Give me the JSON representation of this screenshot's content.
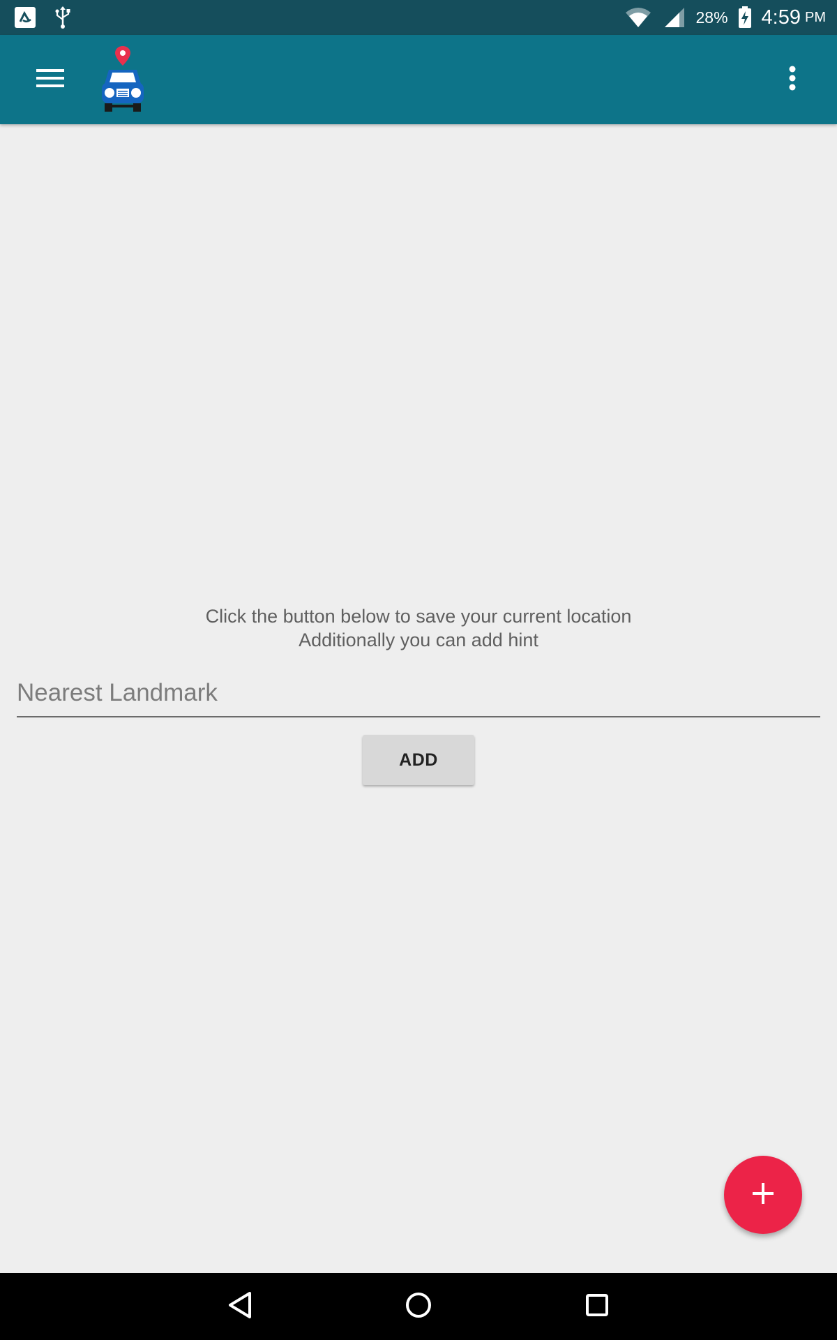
{
  "status_bar": {
    "battery_percent": "28%",
    "time": "4:59",
    "time_suffix": "PM",
    "icons": [
      "app-notification-icon",
      "usb-icon",
      "wifi-icon",
      "cell-signal-icon",
      "battery-charging-icon"
    ]
  },
  "app_bar": {
    "menu_icon": "hamburger-menu-icon",
    "logo_icon": "car-location-logo",
    "overflow_icon": "more-vertical-icon",
    "color": "#0d7489"
  },
  "main": {
    "instruction_line1": "Click the button below to save your current location",
    "instruction_line2": "Additionally you can add hint",
    "landmark_placeholder": "Nearest Landmark",
    "landmark_value": "",
    "add_button_label": "ADD"
  },
  "fab": {
    "icon": "plus-icon",
    "color": "#ec2348"
  },
  "nav_bar": {
    "icons": [
      "back-icon",
      "home-icon",
      "recents-icon"
    ]
  }
}
